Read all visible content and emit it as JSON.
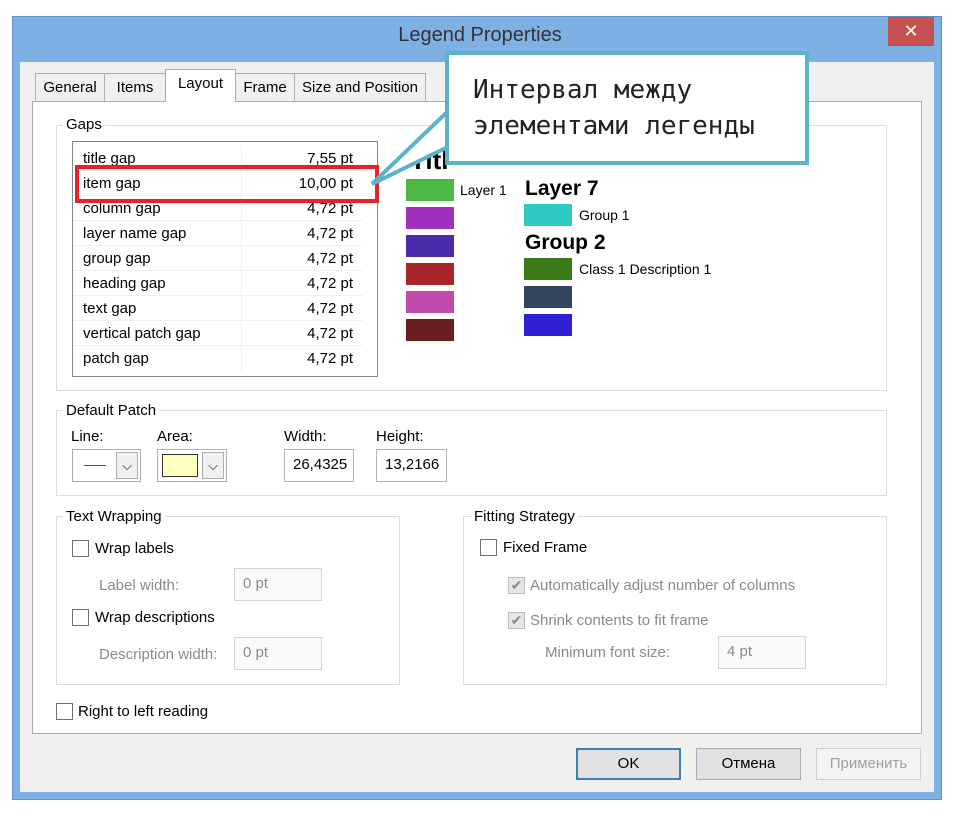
{
  "window": {
    "title": "Legend Properties",
    "close_glyph": "✕"
  },
  "tabs": [
    "General",
    "Items",
    "Layout",
    "Frame",
    "Size and Position"
  ],
  "callout": {
    "line1": "Интервал между",
    "line2": "элементами легенды"
  },
  "gaps": {
    "label": "Gaps",
    "rows": [
      {
        "name": "title gap",
        "value": "7,55 pt"
      },
      {
        "name": "item gap",
        "value": "10,00 pt"
      },
      {
        "name": "column gap",
        "value": "4,72 pt"
      },
      {
        "name": "layer name gap",
        "value": "4,72 pt"
      },
      {
        "name": "group gap",
        "value": "4,72 pt"
      },
      {
        "name": "heading gap",
        "value": "4,72 pt"
      },
      {
        "name": "text gap",
        "value": "4,72 pt"
      },
      {
        "name": "vertical patch gap",
        "value": "4,72 pt"
      },
      {
        "name": "patch gap",
        "value": "4,72 pt"
      }
    ]
  },
  "preview": {
    "title": "Title",
    "layer1": "Layer 1",
    "layer7": "Layer 7",
    "group1": "Group 1",
    "group2": "Group 2",
    "class1": "Class 1 Description 1",
    "colors": {
      "col1": [
        "#4cb944",
        "#a030bf",
        "#4a2aa8",
        "#a8262a",
        "#c24aad",
        "#6b1e22"
      ],
      "group1": "#2ecbc4",
      "col2": [
        "#3a7a18",
        "#33445f",
        "#3020d4"
      ]
    }
  },
  "default_patch": {
    "label": "Default Patch",
    "line_label": "Line:",
    "area_label": "Area:",
    "width_label": "Width:",
    "height_label": "Height:",
    "width_value": "26,4325",
    "height_value": "13,2166",
    "area_color": "#ffffc0"
  },
  "text_wrapping": {
    "label": "Text Wrapping",
    "wrap_labels": "Wrap labels",
    "label_width": "Label width:",
    "label_width_value": "0 pt",
    "wrap_descriptions": "Wrap descriptions",
    "description_width": "Description width:",
    "description_width_value": "0 pt"
  },
  "fitting": {
    "label": "Fitting Strategy",
    "fixed_frame": "Fixed Frame",
    "auto_columns": "Automatically adjust number of columns",
    "shrink": "Shrink contents to fit frame",
    "min_font": "Minimum font size:",
    "min_font_value": "4 pt"
  },
  "rtl": "Right to left reading",
  "buttons": {
    "ok": "OK",
    "cancel": "Отмена",
    "apply": "Применить"
  }
}
